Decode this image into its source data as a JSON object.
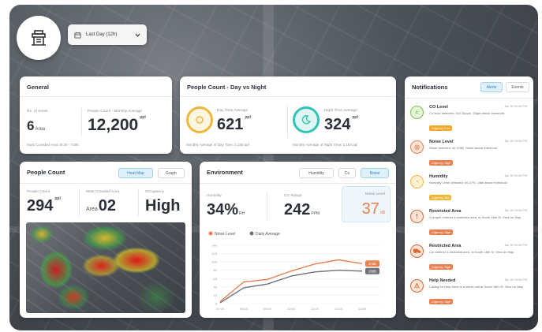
{
  "header": {
    "logo_icon": "building-logo-icon",
    "range_dropdown": {
      "icon": "calendar-icon",
      "value": "Last Day (12h)",
      "chevron": "chevron-down-icon"
    }
  },
  "general": {
    "title": "General",
    "no_of_areas_label": "No. of Areas",
    "no_of_areas_value": "6",
    "no_of_areas_unit": "Area",
    "people_count_label": "People Count - Monthly Average",
    "people_count_value": "12,200",
    "people_count_unit": "ppl",
    "footer": "Most Crowded Area: B-20 - 7185"
  },
  "day_night": {
    "title": "People Count - Day vs Night",
    "day_label": "Day Time Average",
    "day_value": "621",
    "day_unit": "ppl",
    "day_footer": "Monthly Average of Day Time: 2,155 ppl",
    "night_label": "Night Time Average",
    "night_value": "324",
    "night_unit": "ppl",
    "night_footer": "Monthly Average of Night Time: 2,154 ppl",
    "day_color": "#f0b63a",
    "night_color": "#2ec4b6"
  },
  "people_count": {
    "title": "People Count",
    "tabs": [
      "Heat Map",
      "Graph"
    ],
    "active_tab": "Heat Map",
    "count_label": "People Count",
    "count_value": "294",
    "count_unit": "ppl",
    "crowded_label": "Most Crowded Area",
    "crowded_prefix": "Area",
    "crowded_value": "02",
    "occupancy_label": "Occupancy",
    "occupancy_value": "High"
  },
  "environment": {
    "title": "Environment",
    "tabs": [
      "Humidity",
      "Co",
      "Noise"
    ],
    "active_tab": "Noise",
    "humidity_label": "Humidity",
    "humidity_value": "34%",
    "humidity_unit": "RH",
    "co2_label": "CO Range",
    "co2_value": "242",
    "co2_unit": "PPM",
    "noise_label": "Noise Level",
    "noise_value": "37",
    "noise_unit": "dB",
    "accent_orange": "#e8804f",
    "accent_grey": "#6d7178"
  },
  "chart_data": {
    "type": "line",
    "x": [
      "07:00",
      "08:00",
      "09:00",
      "10:00",
      "11:00",
      "12:00",
      "13:00"
    ],
    "series": [
      {
        "name": "Noise Level",
        "values": [
          5,
          52,
          58,
          78,
          95,
          105,
          96
        ]
      },
      {
        "name": "Daily Average",
        "values": [
          2,
          38,
          47,
          66,
          76,
          80,
          78
        ]
      }
    ],
    "ylim": [
      0,
      140
    ],
    "yticks": [
      "140",
      "120",
      "100",
      "80",
      "60",
      "40",
      "20",
      "0"
    ],
    "end_labels": [
      "37dB",
      "28dB"
    ],
    "grid": true,
    "legend": "top-left"
  },
  "notifications": {
    "title": "Notifications",
    "tabs": [
      "Alerts",
      "Events"
    ],
    "active_tab": "Alerts",
    "items": [
      {
        "title": "CO Level",
        "time": "Jan 30 09:00 PM",
        "text": "Co level detected: 240.33ppm. Slight above threshold.",
        "tag": "Urgency: Low",
        "tag_color": "#f0a92a",
        "icon": "co-level-icon",
        "icon_color": "#7cc24a",
        "icon_bg": "#e6f4dc"
      },
      {
        "title": "Noise Level",
        "time": "Jan 30 09:00 PM",
        "text": "Noise detected: 40.47dB. Noise above threshold.",
        "tag": "Urgency: High",
        "tag_color": "#e8804f",
        "icon": "noise-level-icon",
        "icon_color": "#e8804f",
        "icon_bg": "#fbe5da"
      },
      {
        "title": "Humidity",
        "time": "Jan 30 09:00 PM",
        "text": "Humidity Level detected: 40.47%. Little above threshold.",
        "tag": "Urgency: Mid",
        "tag_color": "#f0b63a",
        "icon": "humidity-icon",
        "icon_color": "#f0b63a",
        "icon_bg": "#fcefd4"
      },
      {
        "title": "Restricted Area",
        "time": "Jan 30 09:00 PM",
        "text": "2 people entered a restricted area, at South 18th St. View on Map",
        "tag": "Urgency: High",
        "tag_color": "#e8804f",
        "icon": "restricted-area-icon",
        "icon_color": "#d9682f",
        "icon_bg": "#fbe5da"
      },
      {
        "title": "Restricted Area",
        "time": "Jan 30 09:00 PM",
        "text": "Car entered a restricted area, at South 18th St. View on Map",
        "tag": "Urgency: High",
        "tag_color": "#e8804f",
        "icon": "car-restricted-icon",
        "icon_color": "#d9682f",
        "icon_bg": "#fbe5da"
      },
      {
        "title": "Help Needed",
        "time": "Jan 30 09:00 PM",
        "text": "Calling for Help there is a stress call at South 18th St. View on Map",
        "tag": "Urgency: High",
        "tag_color": "#e8804f",
        "icon": "help-alert-icon",
        "icon_color": "#d9682f",
        "icon_bg": "#fbe5da"
      }
    ]
  }
}
